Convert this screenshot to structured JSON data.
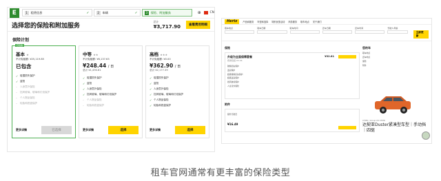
{
  "europcar": {
    "logo": "E",
    "steps": [
      {
        "num": "1",
        "label": "租赁信息"
      },
      {
        "num": "2",
        "label": "车辆"
      },
      {
        "num": "3",
        "label": "保险、附加服务"
      }
    ],
    "lang": "CN",
    "title": "选择您的保险和附加服务",
    "total_label": "总计",
    "total_amount": "¥3,717.90",
    "cta": "查看费用明细",
    "section_title": "保险计划",
    "cards": [
      {
        "badge": "已包含",
        "name": "基本",
        "excess": "不计免赔额: ¥25,119.85",
        "price": "已包含",
        "per": "",
        "total": "",
        "features": [
          {
            "text": "碰撞损失保护",
            "on": true
          },
          {
            "text": "盗抢",
            "on": true
          },
          {
            "text": "人身意外保险",
            "on": false
          },
          {
            "text": "挡风玻璃、玻璃和灯泡保护",
            "on": false
          },
          {
            "text": "个人物品保险",
            "on": false
          },
          {
            "text": "轮胎和底盘保护",
            "on": false
          }
        ],
        "more": "更多详情",
        "button": "已选择"
      },
      {
        "badge": "",
        "name": "中等",
        "excess": "不计免赔额: ¥6,137.63",
        "price": "¥248.44",
        "per": "/ 日",
        "total": "总计 ¥1,490.61",
        "features": [
          {
            "text": "碰撞损失保护",
            "on": true
          },
          {
            "text": "盗抢",
            "on": true
          },
          {
            "text": "人身意外保险",
            "on": true
          },
          {
            "text": "挡风玻璃、玻璃和灯泡保护",
            "on": true
          },
          {
            "text": "个人物品保险",
            "on": false
          },
          {
            "text": "轮胎和底盘保护",
            "on": false
          }
        ],
        "more": "更多详情",
        "button": "选择"
      },
      {
        "badge": "",
        "name": "高档",
        "excess": "不计免赔额: ¥0.00",
        "price": "¥362.90",
        "per": "/ 日",
        "total": "总计 ¥2,177.39",
        "features": [
          {
            "text": "碰撞损失保护",
            "on": true
          },
          {
            "text": "盗抢",
            "on": true
          },
          {
            "text": "人身意外保险",
            "on": true
          },
          {
            "text": "挡风玻璃、玻璃和灯泡保护",
            "on": true
          },
          {
            "text": "个人物品保险",
            "on": true
          },
          {
            "text": "轮胎和底盘保护",
            "on": true
          }
        ],
        "more": "更多详情",
        "button": "选择"
      }
    ]
  },
  "hertz": {
    "logo": "Hertz",
    "nav": [
      "产品和服务",
      "车型和选择",
      "特别优惠活动",
      "商务服务",
      "取车地点",
      "关于我们"
    ],
    "fields": [
      {
        "label": "取车地点",
        "value": ""
      },
      {
        "label": "取车日期",
        "value": ""
      },
      {
        "label": "取车时间",
        "value": ""
      },
      {
        "label": "还车日期",
        "value": ""
      },
      {
        "label": "还车时间",
        "value": ""
      },
      {
        "label": "驾驶人年龄",
        "value": ""
      }
    ],
    "search_button": "立即更新",
    "section_insurance": "保险",
    "pack_title": "升级为全面保障套餐",
    "pack_sub": "费用包括 ¥3.46",
    "pack_price": "¥32.81",
    "pack_items": [
      "碰撞损失保护",
      "盗窃保护",
      "超级碰撞损失保护",
      "超级盗窃保护",
      "挡风玻璃保护",
      "人身意外保险"
    ],
    "section_extras": "附件",
    "extra_title": "额外驾驶员",
    "extra_price": "¥16.49",
    "sidebar_title": "您的车",
    "sidebar_rows": [
      "取车地点",
      "还车地点",
      "保险",
      "附件"
    ],
    "car_sub": "CTMR | Group C6 CTMR",
    "car_name": "达契亚Duster紧凑型车型｜手动挡｜四驱"
  },
  "caption": "租车官网通常有更丰富的保险类型"
}
